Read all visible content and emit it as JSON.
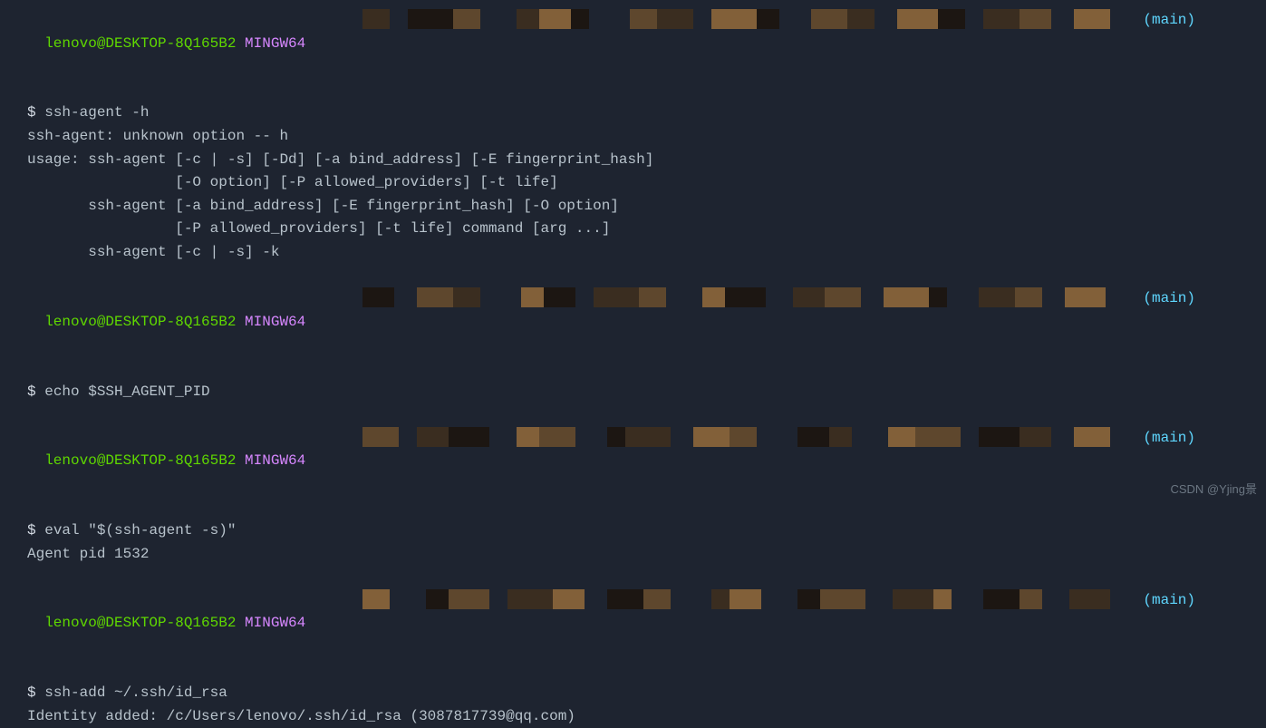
{
  "prompt": {
    "user_host": "lenovo@DESKTOP-8Q165B2",
    "shell": "MINGW64",
    "branch": "(main)",
    "symbol": "$"
  },
  "blocks": [
    {
      "command": "ssh-agent -h",
      "output": [
        "ssh-agent: unknown option -- h",
        "usage: ssh-agent [-c | -s] [-Dd] [-a bind_address] [-E fingerprint_hash]",
        "                 [-O option] [-P allowed_providers] [-t life]",
        "       ssh-agent [-a bind_address] [-E fingerprint_hash] [-O option]",
        "                 [-P allowed_providers] [-t life] command [arg ...]",
        "       ssh-agent [-c | -s] -k"
      ]
    },
    {
      "command": "echo $SSH_AGENT_PID",
      "output": [
        ""
      ]
    },
    {
      "command": "eval \"$(ssh-agent -s)\"",
      "output": [
        "Agent pid 1532"
      ]
    },
    {
      "command": "ssh-add ~/.ssh/id_rsa",
      "output": [
        "Identity added: /c/Users/lenovo/.ssh/id_rsa (3087817739@qq.com)"
      ]
    }
  ],
  "watermark": "CSDN @Yjing景"
}
